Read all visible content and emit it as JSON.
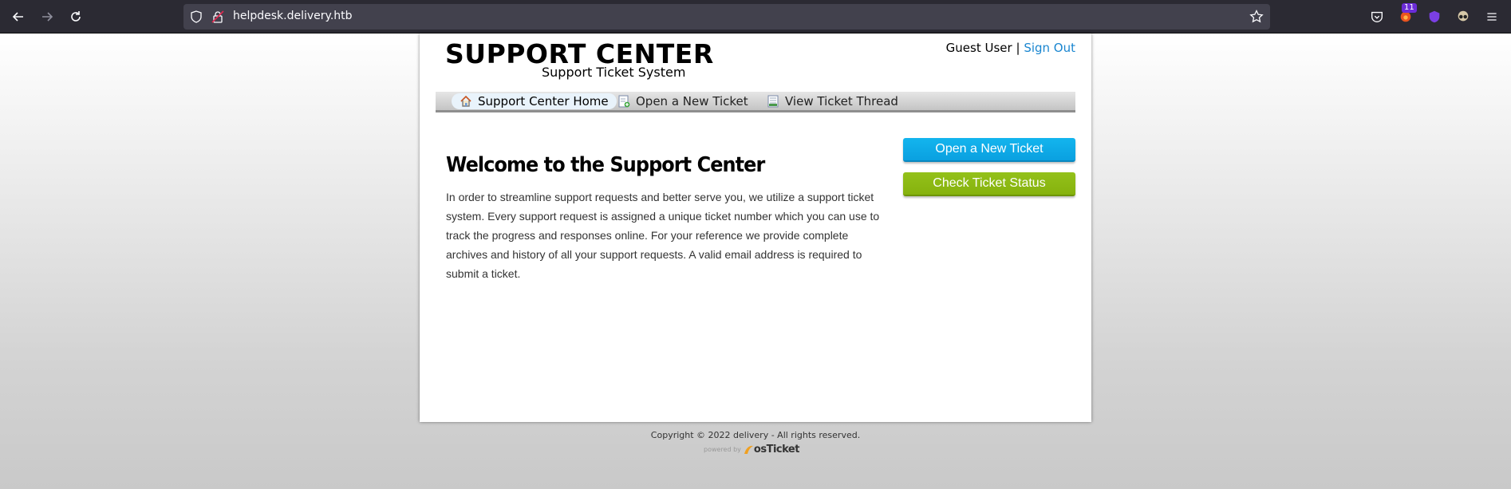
{
  "browser": {
    "url": "helpdesk.delivery.htb",
    "badge_count": "11"
  },
  "header": {
    "logo_title": "SUPPORT CENTER",
    "logo_subtitle": "Support Ticket System",
    "user_label": "Guest User",
    "separator": "|",
    "sign_out": "Sign Out"
  },
  "nav": {
    "items": [
      {
        "label": "Support Center Home",
        "icon": "home-icon",
        "active": true
      },
      {
        "label": "Open a New Ticket",
        "icon": "new-ticket-icon",
        "active": false
      },
      {
        "label": "View Ticket Thread",
        "icon": "ticket-thread-icon",
        "active": false
      }
    ]
  },
  "main": {
    "heading": "Welcome to the Support Center",
    "intro": "In order to streamline support requests and better serve you, we utilize a support ticket system. Every support request is assigned a unique ticket number which you can use to track the progress and responses online. For your reference we provide complete archives and history of all your support requests. A valid email address is required to submit a ticket."
  },
  "sidebar": {
    "open_ticket_button": "Open a New Ticket",
    "check_status_button": "Check Ticket Status"
  },
  "footer": {
    "copyright": "Copyright © 2022 delivery - All rights reserved.",
    "powered_by": "powered by",
    "brand": "osTicket"
  },
  "colors": {
    "link": "#1a86d0",
    "blue_button": "#0aa0e0",
    "green_button": "#86b20e"
  }
}
